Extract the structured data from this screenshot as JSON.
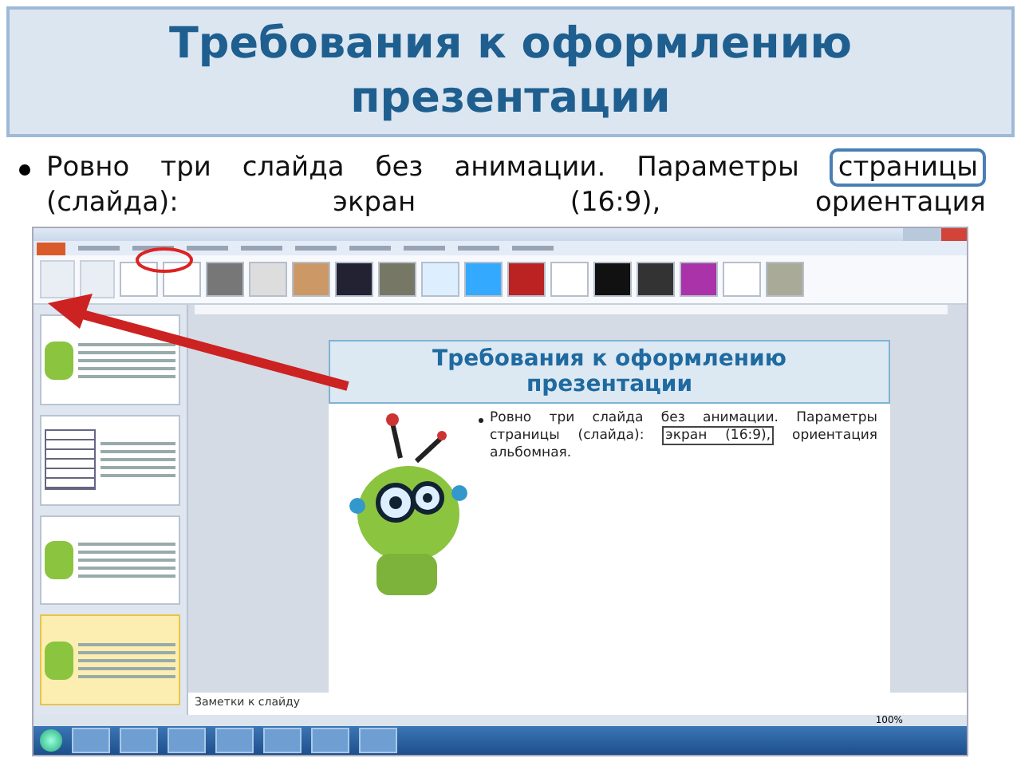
{
  "slide": {
    "title": "Требования к оформлению презентации",
    "bullet": {
      "before": "Ровно три слайда без анимации. Параметры",
      "boxed": "страницы",
      "after": "(слайда): экран (16:9), ориентация"
    }
  },
  "screenshot": {
    "thumbnails": [
      {
        "kind": "robot",
        "selected": false
      },
      {
        "kind": "table",
        "selected": false
      },
      {
        "kind": "robot",
        "selected": false
      },
      {
        "kind": "robot",
        "selected": true
      }
    ],
    "inner_slide": {
      "title": "Требования к оформлению презентации",
      "before": "Ровно три слайда без анимации. Параметры страницы (слайда):",
      "boxed": "экран (16:9),",
      "after": "ориентация альбомная."
    },
    "notes_placeholder": "Заметки к слайду",
    "zoom": "100%"
  }
}
